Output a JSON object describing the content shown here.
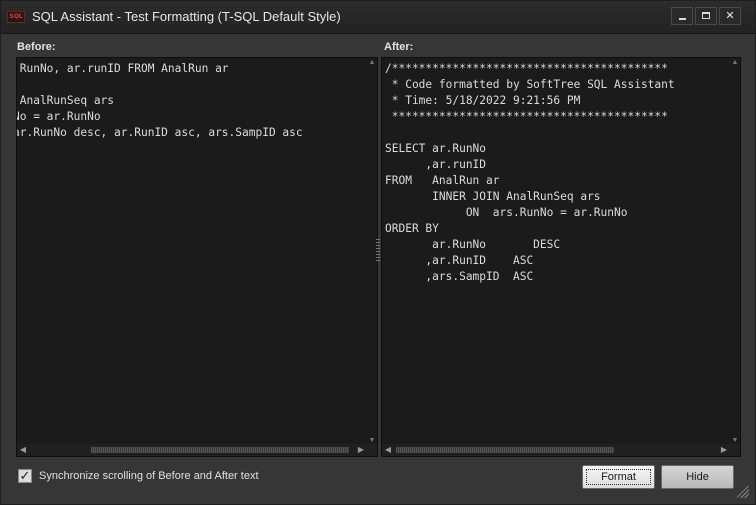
{
  "window": {
    "logo_text": "SQL",
    "title": "SQL Assistant - Test Formatting (T-SQL Default Style)",
    "buttons": {
      "minimize": "minimize",
      "maximize": "maximize",
      "close": "✕"
    }
  },
  "before": {
    "label": "Before:",
    "code": " RunNo, ar.runID FROM AnalRun ar\n\n AnalRunSeq ars\nNo = ar.RunNo\nar.RunNo desc, ar.RunID asc, ars.SampID asc"
  },
  "after": {
    "label": "After:",
    "code": "/*****************************************\n * Code formatted by SoftTree SQL Assistant\n * Time: 5/18/2022 9:21:56 PM\n *****************************************\n\nSELECT ar.RunNo\n      ,ar.runID\nFROM   AnalRun ar\n       INNER JOIN AnalRunSeq ars\n            ON  ars.RunNo = ar.RunNo\nORDER BY\n       ar.RunNo       DESC\n      ,ar.RunID    ASC\n      ,ars.SampID  ASC"
  },
  "options": {
    "sync_scroll_label": "Synchronize scrolling of Before and After text",
    "sync_scroll_checked": true
  },
  "actions": {
    "format_label": "Format",
    "hide_label": "Hide"
  }
}
